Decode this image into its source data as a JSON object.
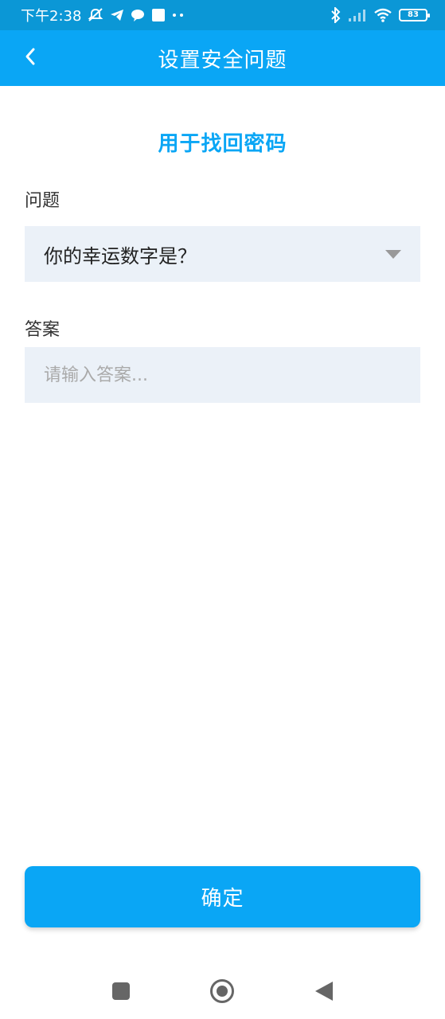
{
  "status_bar": {
    "time": "下午2:38",
    "battery_level": "83",
    "icons": [
      "mute-icon",
      "telegram-icon",
      "chat-bubble-icon",
      "square-notification-icon",
      "more-dots-icon",
      "bluetooth-icon",
      "signal-icon",
      "wifi-icon",
      "battery-icon"
    ]
  },
  "app_bar": {
    "title": "设置安全问题",
    "back_icon": "chevron-left-icon"
  },
  "form": {
    "subtitle": "用于找回密码",
    "question_label": "问题",
    "question_value": "你的幸运数字是？",
    "answer_label": "答案",
    "answer_placeholder": "请输入答案...",
    "answer_value": "",
    "confirm_label": "确定"
  },
  "nav_bar": {
    "items": [
      "recent-apps-icon",
      "home-icon",
      "back-triangle-icon"
    ]
  },
  "colors": {
    "status_bar": "#0b97d6",
    "primary": "#0aa6f5",
    "input_bg": "#ebf1f8"
  }
}
